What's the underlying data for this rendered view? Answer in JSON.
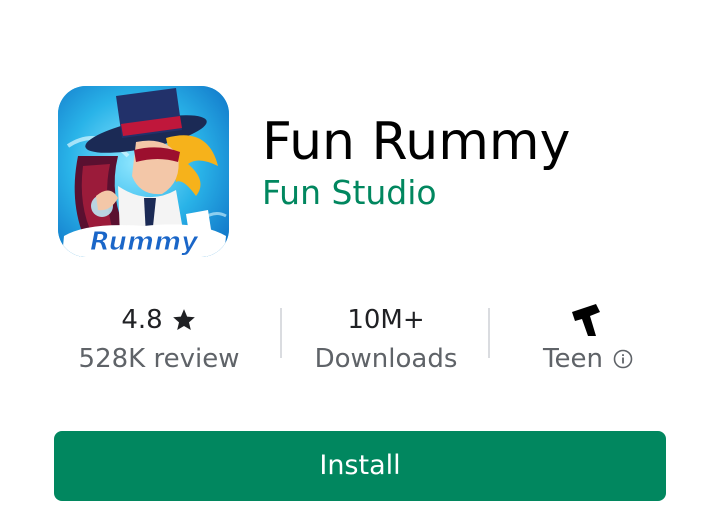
{
  "app": {
    "title": "Fun Rummy",
    "developer": "Fun Studio",
    "icon_text": "Rummy"
  },
  "stats": {
    "rating": {
      "value": "4.8",
      "icon": "star-icon",
      "subtitle": "528K review"
    },
    "downloads": {
      "value": "10M+",
      "subtitle": "Downloads"
    },
    "content_rating": {
      "icon": "teen-rating-icon",
      "label": "Teen",
      "info_icon": "info-icon"
    }
  },
  "install": {
    "label": "Install"
  },
  "colors": {
    "accent": "#01875f",
    "text_primary": "#000000",
    "text_secondary": "#5f6368",
    "divider": "#dadce0"
  }
}
